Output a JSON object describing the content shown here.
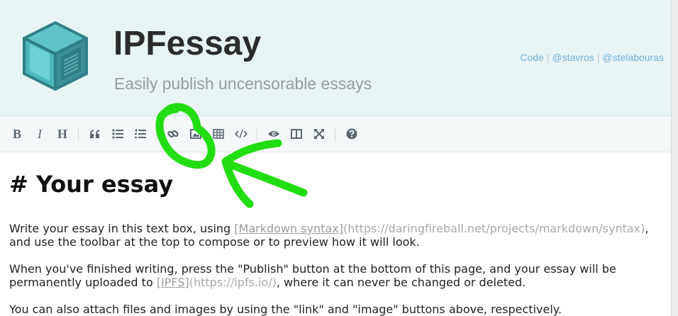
{
  "header": {
    "title": "IPFessay",
    "subtitle": "Easily publish uncensorable essays",
    "links": [
      {
        "label": "Code"
      },
      {
        "label": "@stavros"
      },
      {
        "label": "@stelabouras"
      }
    ],
    "separator": "|"
  },
  "toolbar": {
    "bold_label": "B",
    "italic_label": "I",
    "heading_label": "H"
  },
  "editor": {
    "heading": "# Your essay",
    "p1": {
      "before": "Write your essay in this text box, using ",
      "link_text": "[Markdown syntax]",
      "link_url": "(https://daringfireball.net/projects/markdown/syntax)",
      "after": ",",
      "line2": "and use the toolbar at the top to compose or to preview how it will look."
    },
    "p2": {
      "line1": "When you've finished writing, press the \"Publish\" button at the bottom of this page, and your essay will be",
      "before": "permanently uploaded to ",
      "link_text": "[IPFS]",
      "link_url": "(https://ipfs.io/)",
      "after": ", where it can never be changed or deleted."
    },
    "p3": "You can also attach files and images by using the \"link\" and \"image\" buttons above, respectively."
  },
  "colors": {
    "header_bg": "#e8f4f4",
    "link": "#6fb3d8",
    "annotation": "#22dd11"
  }
}
